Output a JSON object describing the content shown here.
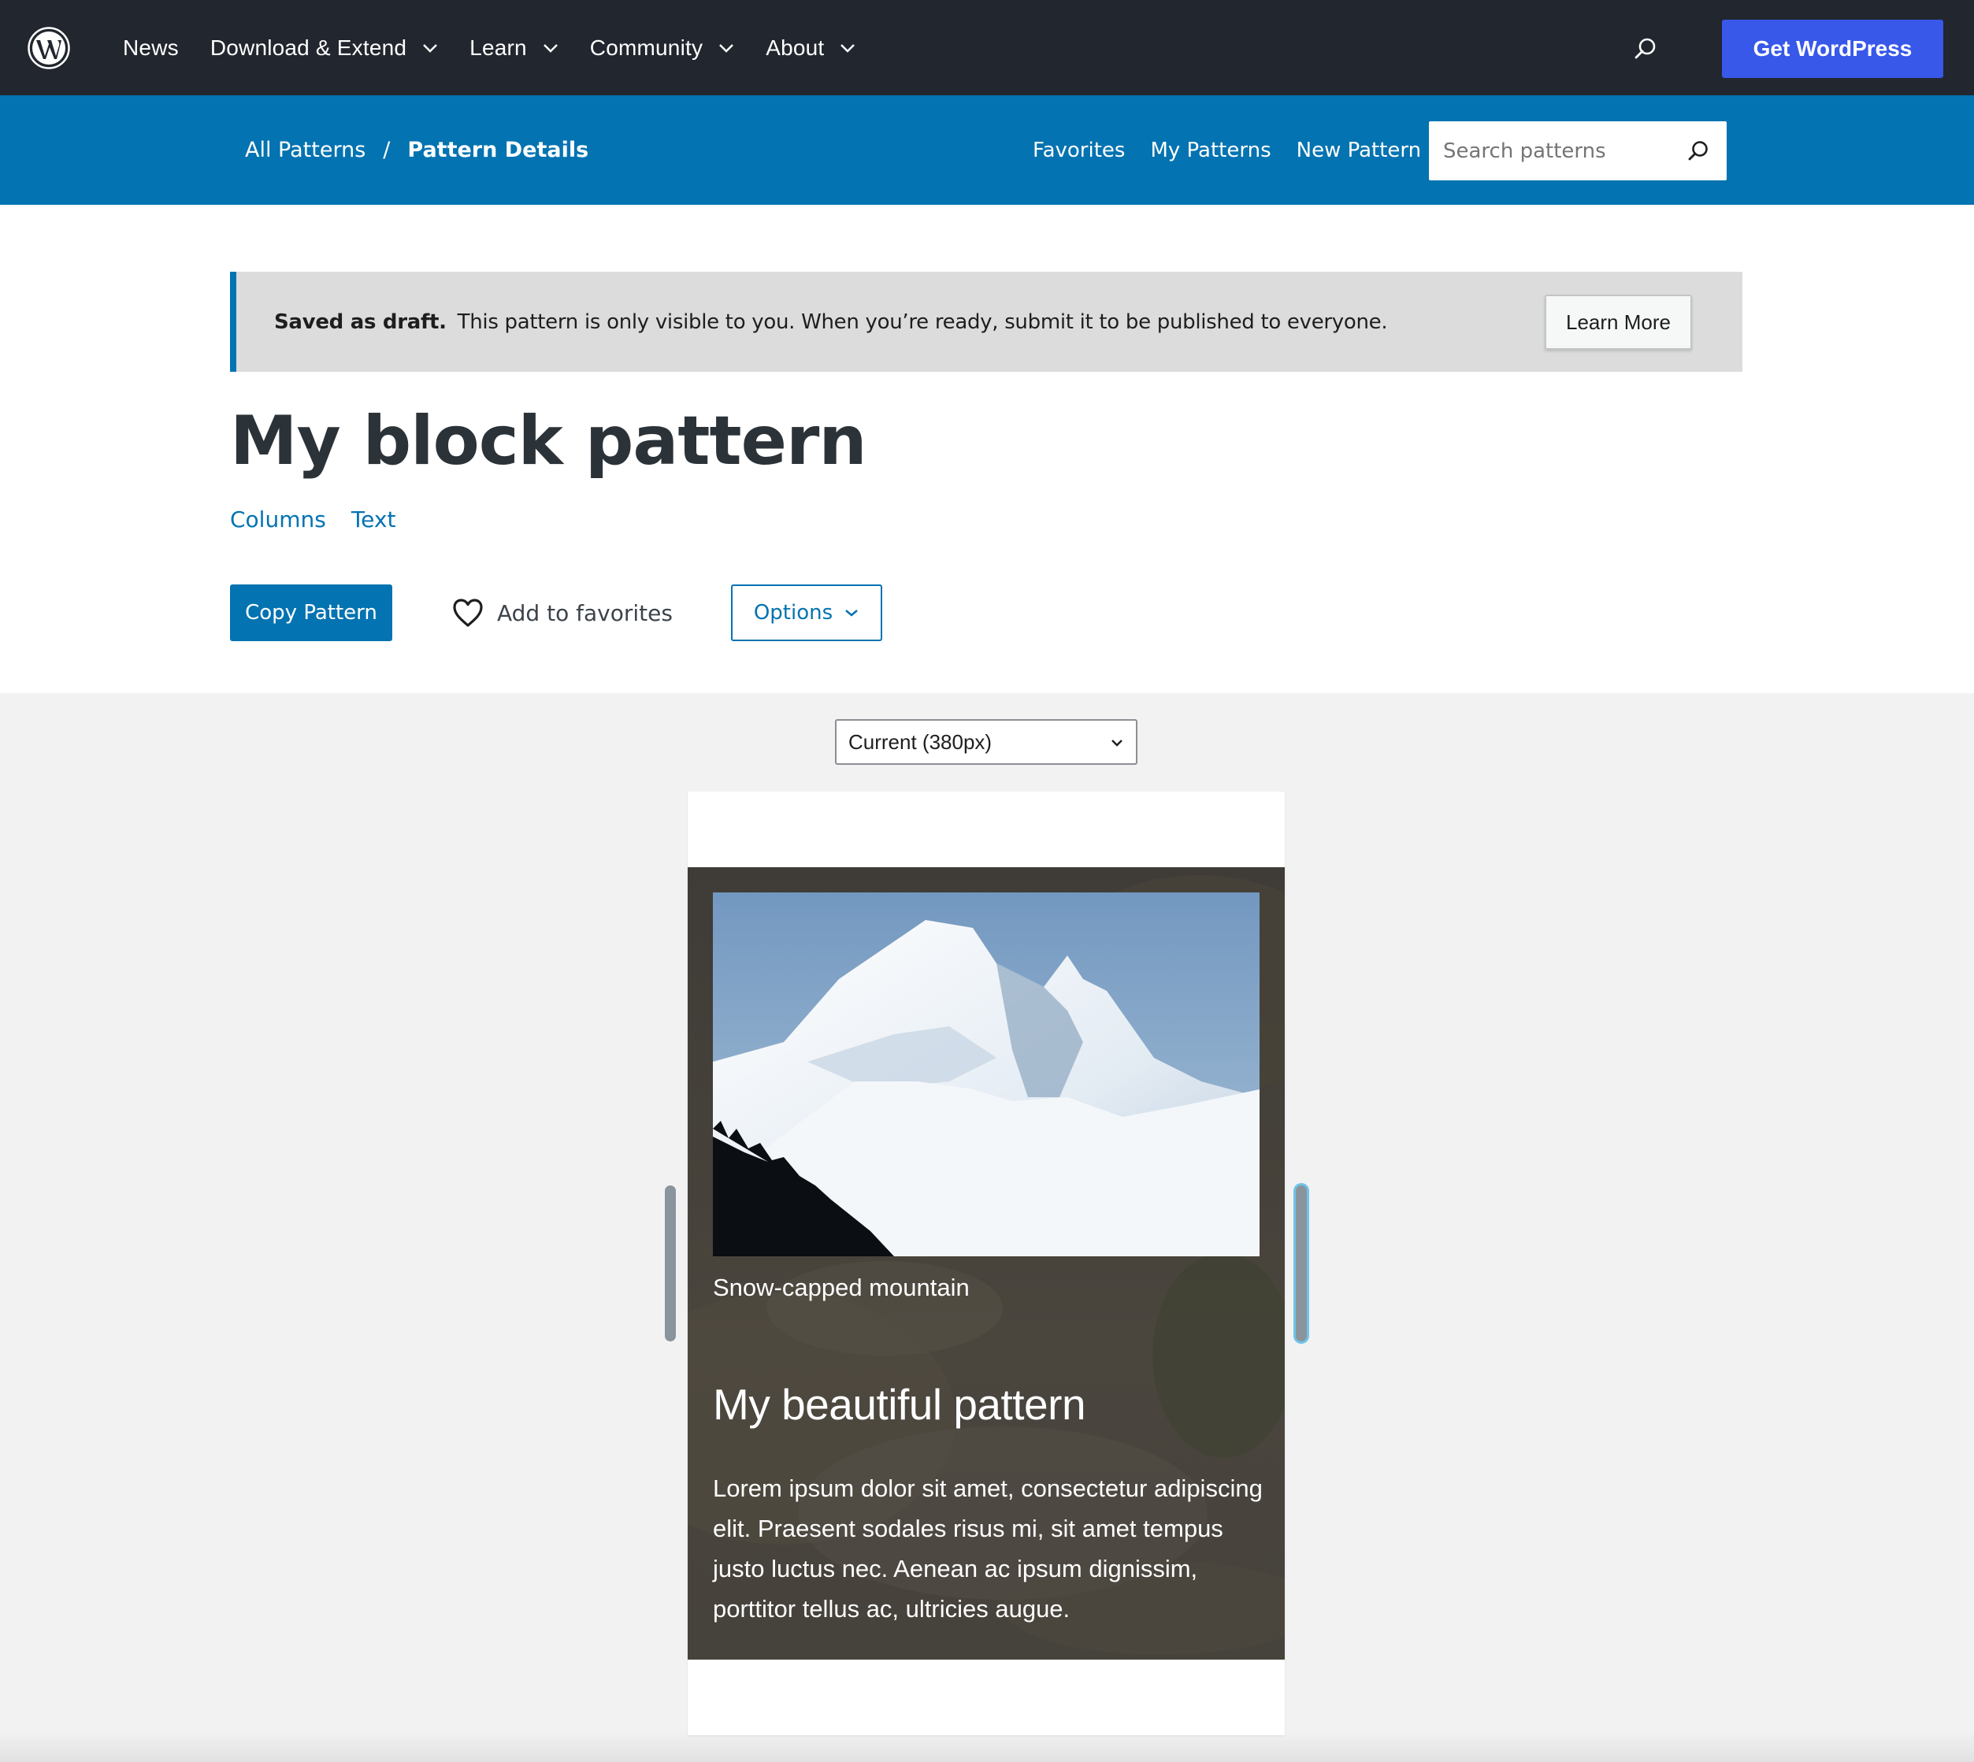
{
  "topbar": {
    "logo": "wordpress-logo",
    "nav": [
      {
        "label": "News",
        "has_dropdown": false
      },
      {
        "label": "Download & Extend",
        "has_dropdown": true
      },
      {
        "label": "Learn",
        "has_dropdown": true
      },
      {
        "label": "Community",
        "has_dropdown": true
      },
      {
        "label": "About",
        "has_dropdown": true
      }
    ],
    "search_icon": "search-icon",
    "cta_label": "Get WordPress"
  },
  "subbar": {
    "breadcrumb": {
      "root": "All Patterns",
      "separator": "/",
      "current": "Pattern Details"
    },
    "links": [
      "Favorites",
      "My Patterns",
      "New Pattern"
    ],
    "search_placeholder": "Search patterns",
    "search_value": ""
  },
  "notice": {
    "strong": "Saved as draft.",
    "text": "This pattern is only visible to you. When you’re ready, submit it to be published to everyone.",
    "button": "Learn More"
  },
  "pattern": {
    "title": "My block pattern",
    "categories": [
      "Columns",
      "Text"
    ],
    "copy_label": "Copy Pattern",
    "favorite_label": "Add to favorites",
    "options_label": "Options"
  },
  "preview": {
    "width_select": "Current (380px)",
    "image_caption": "Snow-capped mountain",
    "heading": "My beautiful pattern",
    "body": "Lorem ipsum dolor sit amet, consectetur adipiscing elit. Praesent sodales risus mi, sit amet tempus justo luctus nec. Aenean ac ipsum dignissim, porttitor tellus ac, ultricies augue."
  },
  "colors": {
    "topbar_bg": "#22262e",
    "brand_blue": "#0473b1",
    "cta_blue": "#3858e9",
    "notice_bg": "#dcdcdc",
    "preview_bg": "#f2f2f2"
  }
}
